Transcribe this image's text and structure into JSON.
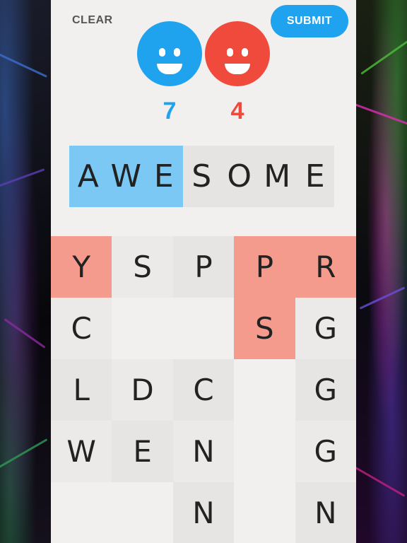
{
  "header": {
    "clear_label": "CLEAR",
    "submit_label": "SUBMIT"
  },
  "players": {
    "blue": {
      "score": "7",
      "color": "#1fa3ef"
    },
    "red": {
      "score": "4",
      "color": "#f04a3c"
    }
  },
  "word": {
    "letters": [
      "A",
      "W",
      "E",
      "S",
      "O",
      "M",
      "E"
    ],
    "blue_owned_count": 3
  },
  "grid": {
    "rows": [
      [
        "Y",
        "S",
        "P",
        "P",
        "R"
      ],
      [
        "C",
        "",
        "",
        "S",
        "G"
      ],
      [
        "L",
        "D",
        "C",
        "",
        "G"
      ],
      [
        "W",
        "E",
        "N",
        "",
        "G"
      ],
      [
        "",
        "",
        "N",
        "",
        "N"
      ]
    ],
    "red_tiles": [
      "0-0",
      "0-3",
      "0-4",
      "1-3"
    ]
  }
}
